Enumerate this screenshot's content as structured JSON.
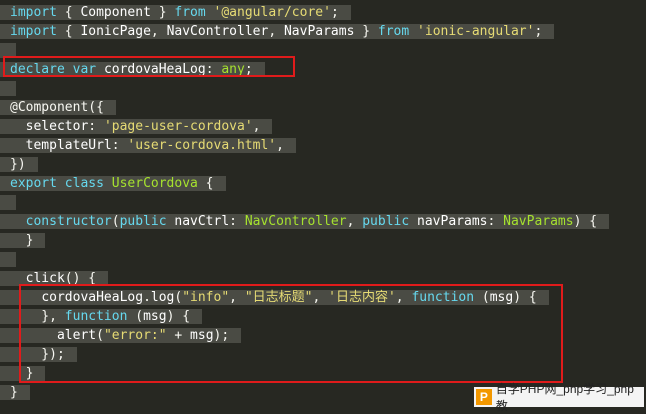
{
  "colors": {
    "background": "#272822",
    "selection": "#4a4b44",
    "keyword": "#66d9ef",
    "string": "#e6db74",
    "type": "#a6e22e",
    "highlight_box": "#e01b1b"
  },
  "lines": [
    [
      {
        "t": "import",
        "c": "kw"
      },
      {
        "t": " { ",
        "c": "punc"
      },
      {
        "t": "Component",
        "c": "id"
      },
      {
        "t": " } ",
        "c": "punc"
      },
      {
        "t": "from",
        "c": "kw"
      },
      {
        "t": " ",
        "c": "punc"
      },
      {
        "t": "'@angular/core'",
        "c": "str"
      },
      {
        "t": ";",
        "c": "punc"
      }
    ],
    [
      {
        "t": "import",
        "c": "kw"
      },
      {
        "t": " { ",
        "c": "punc"
      },
      {
        "t": "IonicPage",
        "c": "id"
      },
      {
        "t": ", ",
        "c": "punc"
      },
      {
        "t": "NavController",
        "c": "id"
      },
      {
        "t": ", ",
        "c": "punc"
      },
      {
        "t": "NavParams",
        "c": "id"
      },
      {
        "t": " } ",
        "c": "punc"
      },
      {
        "t": "from",
        "c": "kw"
      },
      {
        "t": " ",
        "c": "punc"
      },
      {
        "t": "'ionic-angular'",
        "c": "str"
      },
      {
        "t": ";",
        "c": "punc"
      }
    ],
    [],
    [
      {
        "t": "declare",
        "c": "kw"
      },
      {
        "t": " ",
        "c": "punc"
      },
      {
        "t": "var",
        "c": "kw"
      },
      {
        "t": " ",
        "c": "punc"
      },
      {
        "t": "cordovaHeaLog",
        "c": "id"
      },
      {
        "t": ": ",
        "c": "punc"
      },
      {
        "t": "any",
        "c": "typ"
      },
      {
        "t": ";",
        "c": "punc"
      }
    ],
    [],
    [
      {
        "t": "@Component({",
        "c": "dec"
      }
    ],
    [
      {
        "t": "  ",
        "c": "punc"
      },
      {
        "t": "selector",
        "c": "id"
      },
      {
        "t": ": ",
        "c": "punc"
      },
      {
        "t": "'page-user-cordova'",
        "c": "str"
      },
      {
        "t": ",",
        "c": "punc"
      }
    ],
    [
      {
        "t": "  ",
        "c": "punc"
      },
      {
        "t": "templateUrl",
        "c": "id"
      },
      {
        "t": ": ",
        "c": "punc"
      },
      {
        "t": "'user-cordova.html'",
        "c": "str"
      },
      {
        "t": ",",
        "c": "punc"
      }
    ],
    [
      {
        "t": "})",
        "c": "punc"
      }
    ],
    [
      {
        "t": "export",
        "c": "kw"
      },
      {
        "t": " ",
        "c": "punc"
      },
      {
        "t": "class",
        "c": "kw"
      },
      {
        "t": " ",
        "c": "punc"
      },
      {
        "t": "UserCordova",
        "c": "typ"
      },
      {
        "t": " {",
        "c": "punc"
      }
    ],
    [],
    [
      {
        "t": "  ",
        "c": "punc"
      },
      {
        "t": "constructor",
        "c": "kw"
      },
      {
        "t": "(",
        "c": "punc"
      },
      {
        "t": "public",
        "c": "kw"
      },
      {
        "t": " ",
        "c": "punc"
      },
      {
        "t": "navCtrl",
        "c": "id"
      },
      {
        "t": ": ",
        "c": "punc"
      },
      {
        "t": "NavController",
        "c": "typ"
      },
      {
        "t": ", ",
        "c": "punc"
      },
      {
        "t": "public",
        "c": "kw"
      },
      {
        "t": " ",
        "c": "punc"
      },
      {
        "t": "navParams",
        "c": "id"
      },
      {
        "t": ": ",
        "c": "punc"
      },
      {
        "t": "NavParams",
        "c": "typ"
      },
      {
        "t": ") {",
        "c": "punc"
      }
    ],
    [
      {
        "t": "  }",
        "c": "punc"
      }
    ],
    [],
    [
      {
        "t": "  ",
        "c": "punc"
      },
      {
        "t": "click",
        "c": "id"
      },
      {
        "t": "() {",
        "c": "punc"
      }
    ],
    [
      {
        "t": "    ",
        "c": "punc"
      },
      {
        "t": "cordovaHeaLog",
        "c": "id"
      },
      {
        "t": ".",
        "c": "punc"
      },
      {
        "t": "log",
        "c": "fn"
      },
      {
        "t": "(",
        "c": "punc"
      },
      {
        "t": "\"info\"",
        "c": "str"
      },
      {
        "t": ", ",
        "c": "punc"
      },
      {
        "t": "\"日志标题\"",
        "c": "str"
      },
      {
        "t": ", ",
        "c": "punc"
      },
      {
        "t": "'日志内容'",
        "c": "str"
      },
      {
        "t": ", ",
        "c": "punc"
      },
      {
        "t": "function",
        "c": "kw"
      },
      {
        "t": " (",
        "c": "punc"
      },
      {
        "t": "msg",
        "c": "id"
      },
      {
        "t": ") {",
        "c": "punc"
      }
    ],
    [
      {
        "t": "    }, ",
        "c": "punc"
      },
      {
        "t": "function",
        "c": "kw"
      },
      {
        "t": " (",
        "c": "punc"
      },
      {
        "t": "msg",
        "c": "id"
      },
      {
        "t": ") {",
        "c": "punc"
      }
    ],
    [
      {
        "t": "      ",
        "c": "punc"
      },
      {
        "t": "alert",
        "c": "fn"
      },
      {
        "t": "(",
        "c": "punc"
      },
      {
        "t": "\"error:\"",
        "c": "str"
      },
      {
        "t": " + ",
        "c": "punc"
      },
      {
        "t": "msg",
        "c": "id"
      },
      {
        "t": ");",
        "c": "punc"
      }
    ],
    [
      {
        "t": "    });",
        "c": "punc"
      }
    ],
    [
      {
        "t": "  }",
        "c": "punc"
      }
    ],
    [
      {
        "t": "}",
        "c": "punc"
      }
    ]
  ],
  "watermark": {
    "logo": "P",
    "text": "自学PHP网_php学习_php教"
  }
}
